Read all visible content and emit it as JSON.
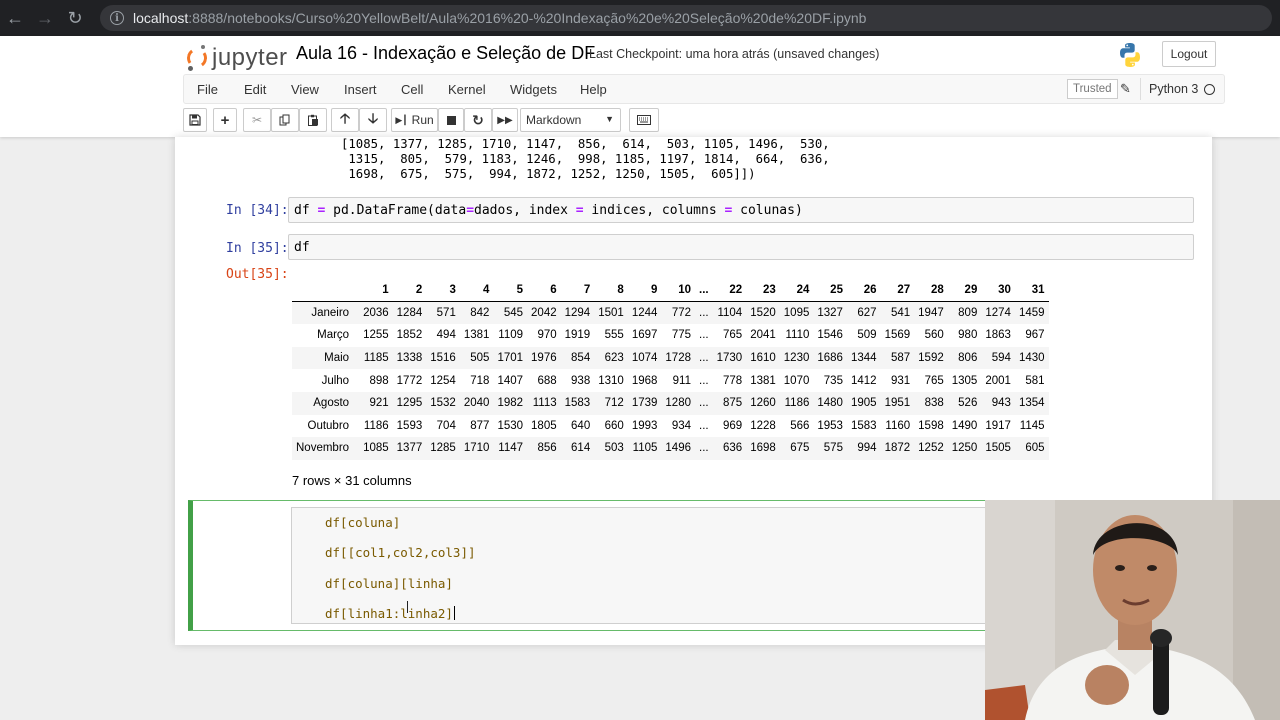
{
  "browser": {
    "url_host": "localhost",
    "url_path": ":8888/notebooks/Curso%20YellowBelt/Aula%2016%20-%20Indexação%20e%20Seleção%20de%20DF.ipynb"
  },
  "header": {
    "logo_text": "jupyter",
    "notebook_name": "Aula 16 - Indexação e Seleção de DF",
    "checkpoint": "Last Checkpoint: uma hora atrás  (unsaved changes)",
    "logout_label": "Logout"
  },
  "menu": [
    "File",
    "Edit",
    "View",
    "Insert",
    "Cell",
    "Kernel",
    "Widgets",
    "Help"
  ],
  "status": {
    "trusted": "Trusted",
    "kernel": "Python 3"
  },
  "toolbar": {
    "run_label": "Run",
    "cell_type": "Markdown",
    "icons": [
      "save-icon",
      "plus-icon",
      "cut-icon",
      "copy-icon",
      "paste-icon",
      "arrow-up-icon",
      "arrow-down-icon",
      "run-icon",
      "stop-icon",
      "restart-icon",
      "fast-forward-icon",
      "keyboard-icon"
    ]
  },
  "array_output": [
    "[1085, 1377, 1285, 1710, 1147,  856,  614,  503, 1105, 1496,  530,",
    " 1315,  805,  579, 1183, 1246,  998, 1185, 1197, 1814,  664,  636,",
    " 1698,  675,  575,  994, 1872, 1252, 1250, 1505,  605]])"
  ],
  "cells": {
    "c34_prompt": "In [34]:",
    "c34_code": "df = pd.DataFrame(data=dados, index = indices, columns = colunas)",
    "c35_prompt": "In [35]:",
    "c35_code": "df",
    "out35_prompt": "Out[35]:"
  },
  "dataframe": {
    "columns": [
      "1",
      "2",
      "3",
      "4",
      "5",
      "6",
      "7",
      "8",
      "9",
      "10",
      "...",
      "22",
      "23",
      "24",
      "25",
      "26",
      "27",
      "28",
      "29",
      "30",
      "31"
    ],
    "rows": [
      {
        "index": "Janeiro",
        "values": [
          "2036",
          "1284",
          "571",
          "842",
          "545",
          "2042",
          "1294",
          "1501",
          "1244",
          "772",
          "...",
          "1104",
          "1520",
          "1095",
          "1327",
          "627",
          "541",
          "1947",
          "809",
          "1274",
          "1459"
        ]
      },
      {
        "index": "Março",
        "values": [
          "1255",
          "1852",
          "494",
          "1381",
          "1109",
          "970",
          "1919",
          "555",
          "1697",
          "775",
          "...",
          "765",
          "2041",
          "1110",
          "1546",
          "509",
          "1569",
          "560",
          "980",
          "1863",
          "967"
        ]
      },
      {
        "index": "Maio",
        "values": [
          "1185",
          "1338",
          "1516",
          "505",
          "1701",
          "1976",
          "854",
          "623",
          "1074",
          "1728",
          "...",
          "1730",
          "1610",
          "1230",
          "1686",
          "1344",
          "587",
          "1592",
          "806",
          "594",
          "1430"
        ]
      },
      {
        "index": "Julho",
        "values": [
          "898",
          "1772",
          "1254",
          "718",
          "1407",
          "688",
          "938",
          "1310",
          "1968",
          "911",
          "...",
          "778",
          "1381",
          "1070",
          "735",
          "1412",
          "931",
          "765",
          "1305",
          "2001",
          "581"
        ]
      },
      {
        "index": "Agosto",
        "values": [
          "921",
          "1295",
          "1532",
          "2040",
          "1982",
          "1113",
          "1583",
          "712",
          "1739",
          "1280",
          "...",
          "875",
          "1260",
          "1186",
          "1480",
          "1905",
          "1951",
          "838",
          "526",
          "943",
          "1354"
        ]
      },
      {
        "index": "Outubro",
        "values": [
          "1186",
          "1593",
          "704",
          "877",
          "1530",
          "1805",
          "640",
          "660",
          "1993",
          "934",
          "...",
          "969",
          "1228",
          "566",
          "1953",
          "1583",
          "1160",
          "1598",
          "1490",
          "1917",
          "1145"
        ]
      },
      {
        "index": "Novembro",
        "values": [
          "1085",
          "1377",
          "1285",
          "1710",
          "1147",
          "856",
          "614",
          "503",
          "1105",
          "1496",
          "...",
          "636",
          "1698",
          "675",
          "575",
          "994",
          "1872",
          "1252",
          "1250",
          "1505",
          "605"
        ]
      }
    ],
    "shape_text": "7 rows × 31 columns"
  },
  "markdown_cell": {
    "lines": [
      "df[coluna]",
      "df[[col1,col2,col3]]",
      "df[coluna][linha]",
      "df[linha1:linha2]"
    ]
  },
  "colors": {
    "in_prompt": "#303f9f",
    "out_prompt": "#d84315",
    "edit_border": "#42a047",
    "jupyter_orange": "#f37726"
  }
}
